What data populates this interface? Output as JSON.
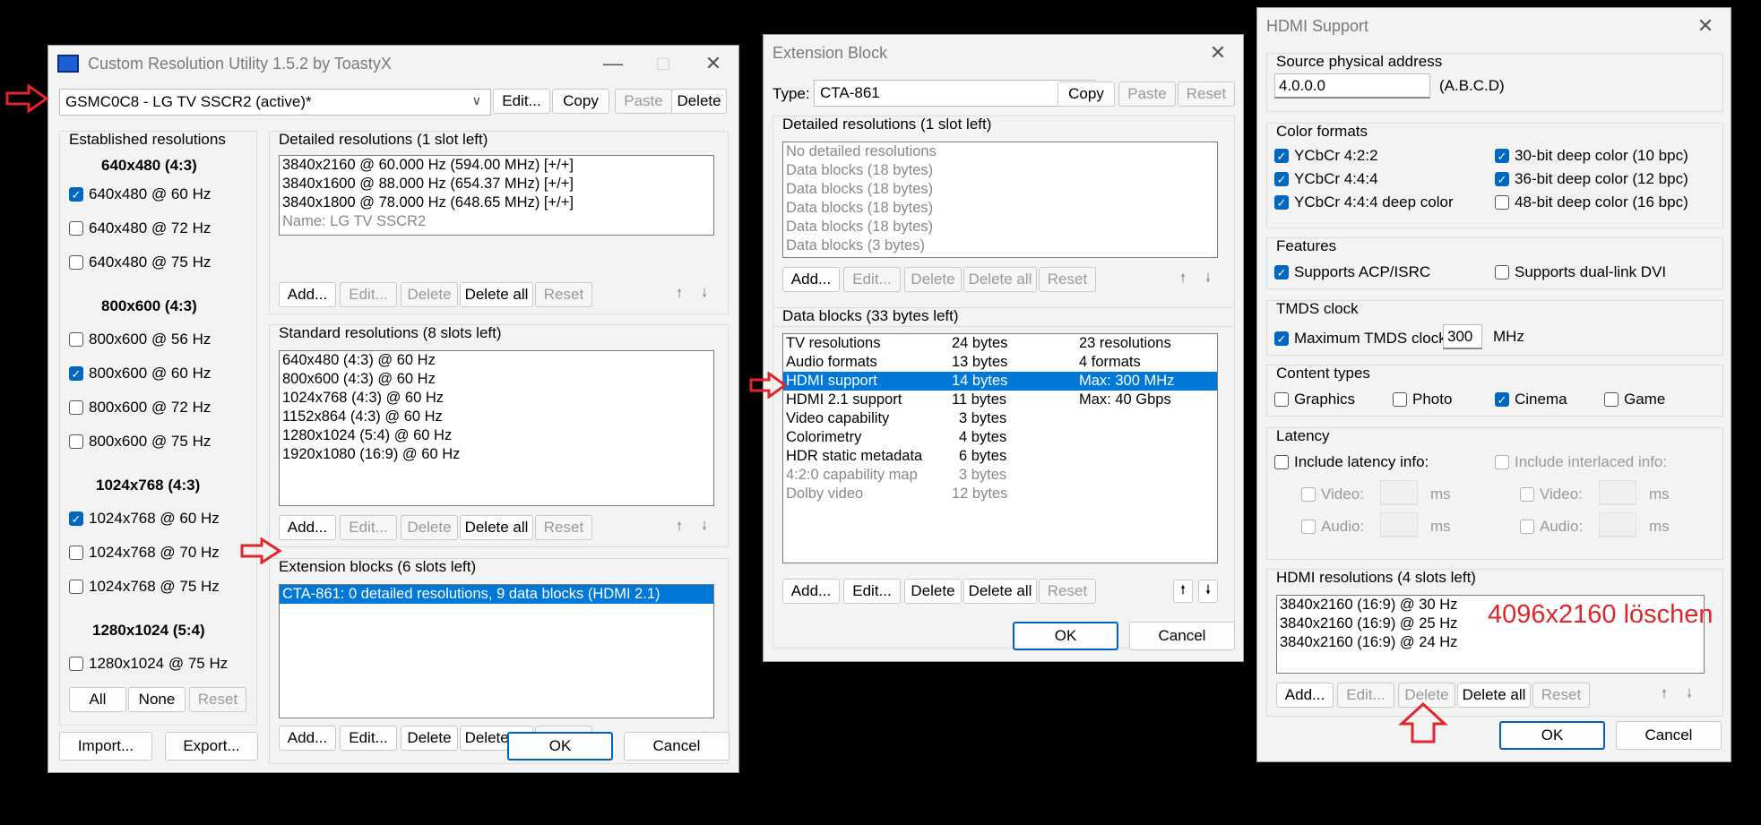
{
  "cru": {
    "title": "Custom Resolution Utility 1.5.2 by ToastyX",
    "monitor": "GSMC0C8 - LG TV SSCR2 (active)*",
    "top_buttons": {
      "edit": "Edit...",
      "copy": "Copy",
      "paste": "Paste",
      "delete": "Delete"
    },
    "established": {
      "label": "Established resolutions",
      "groups": [
        {
          "header": "640x480 (4:3)",
          "items": [
            {
              "label": "640x480 @ 60 Hz",
              "checked": true
            },
            {
              "label": "640x480 @ 72 Hz",
              "checked": false
            },
            {
              "label": "640x480 @ 75 Hz",
              "checked": false
            }
          ]
        },
        {
          "header": "800x600 (4:3)",
          "items": [
            {
              "label": "800x600 @ 56 Hz",
              "checked": false
            },
            {
              "label": "800x600 @ 60 Hz",
              "checked": true
            },
            {
              "label": "800x600 @ 72 Hz",
              "checked": false
            },
            {
              "label": "800x600 @ 75 Hz",
              "checked": false
            }
          ]
        },
        {
          "header": "1024x768 (4:3)",
          "items": [
            {
              "label": "1024x768 @ 60 Hz",
              "checked": true
            },
            {
              "label": "1024x768 @ 70 Hz",
              "checked": false
            },
            {
              "label": "1024x768 @ 75 Hz",
              "checked": false
            }
          ]
        },
        {
          "header": "1280x1024 (5:4)",
          "items": [
            {
              "label": "1280x1024 @ 75 Hz",
              "checked": false
            }
          ]
        }
      ],
      "buttons": {
        "all": "All",
        "none": "None",
        "reset": "Reset"
      }
    },
    "detailed": {
      "label": "Detailed resolutions (1 slot left)",
      "items": [
        "3840x2160 @ 60.000 Hz (594.00 MHz) [+/+]",
        "3840x1600 @ 88.000 Hz (654.37 MHz) [+/+]",
        "3840x1800 @ 78.000 Hz (648.65 MHz) [+/+]"
      ],
      "name_line": "Name: LG TV SSCR2"
    },
    "standard": {
      "label": "Standard resolutions (8 slots left)",
      "items": [
        "640x480 (4:3) @ 60 Hz",
        "800x600 (4:3) @ 60 Hz",
        "1024x768 (4:3) @ 60 Hz",
        "1152x864 (4:3) @ 60 Hz",
        "1280x1024 (5:4) @ 60 Hz",
        "1920x1080 (16:9) @ 60 Hz"
      ]
    },
    "extension": {
      "label": "Extension blocks (6 slots left)",
      "items": [
        "CTA-861: 0 detailed resolutions, 9 data blocks (HDMI 2.1)"
      ]
    },
    "list_buttons": {
      "add": "Add...",
      "edit": "Edit...",
      "delete": "Delete",
      "delete_all": "Delete all",
      "reset": "Reset"
    },
    "bottom": {
      "import": "Import...",
      "export": "Export...",
      "ok": "OK",
      "cancel": "Cancel"
    }
  },
  "ext": {
    "title": "Extension Block",
    "type_label": "Type:",
    "type_value": "CTA-861",
    "top_buttons": {
      "copy": "Copy",
      "paste": "Paste",
      "reset": "Reset"
    },
    "detailed": {
      "label": "Detailed resolutions (1 slot left)",
      "items": [
        "No detailed resolutions",
        "Data blocks (18 bytes)",
        "Data blocks (18 bytes)",
        "Data blocks (18 bytes)",
        "Data blocks (18 bytes)",
        "Data blocks (3 bytes)"
      ]
    },
    "datablocks": {
      "label": "Data blocks (33 bytes left)",
      "rows": [
        {
          "name": "TV resolutions",
          "size": "24 bytes",
          "info": "23 resolutions"
        },
        {
          "name": "Audio formats",
          "size": "13 bytes",
          "info": "4 formats"
        },
        {
          "name": "HDMI support",
          "size": "14 bytes",
          "info": "Max: 300 MHz"
        },
        {
          "name": "HDMI 2.1 support",
          "size": "11 bytes",
          "info": "Max: 40 Gbps"
        },
        {
          "name": "Video capability",
          "size": "3 bytes",
          "info": ""
        },
        {
          "name": "Colorimetry",
          "size": "4 bytes",
          "info": ""
        },
        {
          "name": "HDR static metadata",
          "size": "6 bytes",
          "info": ""
        },
        {
          "name": "4:2:0 capability map",
          "size": "3 bytes",
          "info": ""
        },
        {
          "name": "Dolby video",
          "size": "12 bytes",
          "info": ""
        }
      ]
    },
    "list_buttons": {
      "add": "Add...",
      "edit": "Edit...",
      "delete": "Delete",
      "delete_all": "Delete all",
      "reset": "Reset"
    },
    "bottom": {
      "ok": "OK",
      "cancel": "Cancel"
    }
  },
  "hdmi": {
    "title": "HDMI Support",
    "source": {
      "label": "Source physical address",
      "value": "4.0.0.0",
      "hint": "(A.B.C.D)"
    },
    "color": {
      "label": "Color formats",
      "left": [
        {
          "label": "YCbCr 4:2:2",
          "checked": true
        },
        {
          "label": "YCbCr 4:4:4",
          "checked": true
        },
        {
          "label": "YCbCr 4:4:4 deep color",
          "checked": true
        }
      ],
      "right": [
        {
          "label": "30-bit deep color (10 bpc)",
          "checked": true
        },
        {
          "label": "36-bit deep color (12 bpc)",
          "checked": true
        },
        {
          "label": "48-bit deep color (16 bpc)",
          "checked": false
        }
      ]
    },
    "features": {
      "label": "Features",
      "acp": "Supports ACP/ISRC",
      "dual": "Supports dual-link DVI"
    },
    "tmds": {
      "label": "TMDS clock",
      "cb": "Maximum TMDS clock:",
      "value": "300",
      "unit": "MHz"
    },
    "content": {
      "label": "Content types",
      "items": [
        {
          "label": "Graphics",
          "checked": false
        },
        {
          "label": "Photo",
          "checked": false
        },
        {
          "label": "Cinema",
          "checked": true
        },
        {
          "label": "Game",
          "checked": false
        }
      ]
    },
    "latency": {
      "label": "Latency",
      "include": "Include latency info:",
      "interlaced": "Include interlaced info:",
      "video": "Video:",
      "audio": "Audio:",
      "ms": "ms"
    },
    "res": {
      "label": "HDMI resolutions (4 slots left)",
      "items": [
        "3840x2160 (16:9) @ 30 Hz",
        "3840x2160 (16:9) @ 25 Hz",
        "3840x2160 (16:9) @ 24 Hz"
      ]
    },
    "list_buttons": {
      "add": "Add...",
      "edit": "Edit...",
      "delete": "Delete",
      "delete_all": "Delete all",
      "reset": "Reset"
    },
    "bottom": {
      "ok": "OK",
      "cancel": "Cancel"
    }
  },
  "annotation": {
    "text": "4096x2160 löschen",
    "color": "#e0262a"
  }
}
